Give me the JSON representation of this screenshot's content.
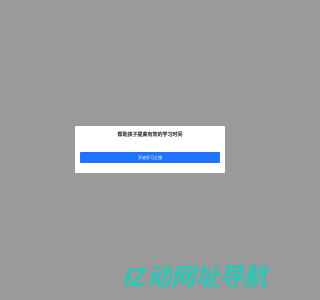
{
  "modal": {
    "title": "帮助孩子提高有效的学习时间",
    "primary_button_label": "开始学习之旅"
  },
  "watermark": {
    "logo_text": "IZ",
    "text": "动网址导航"
  },
  "colors": {
    "overlay": "#9a9a9a",
    "modal_bg": "#ffffff",
    "primary": "#1f74ff",
    "watermark": "#28c7b7"
  }
}
